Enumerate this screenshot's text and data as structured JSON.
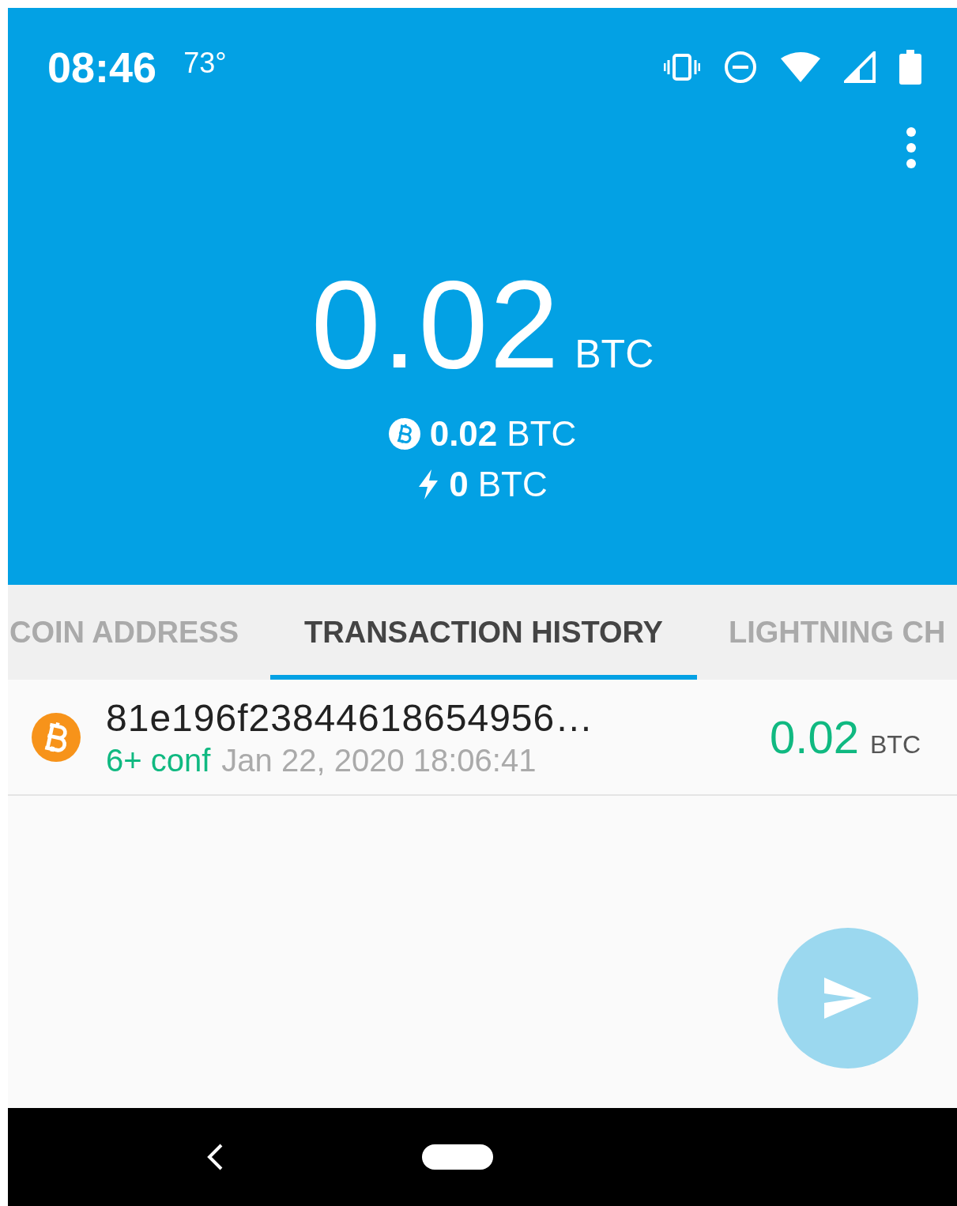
{
  "status_bar": {
    "time": "08:46",
    "temperature": "73°"
  },
  "balance": {
    "amount": "0.02",
    "unit": "BTC"
  },
  "sub_balances": [
    {
      "kind": "onchain",
      "amount": "0.02",
      "unit": "BTC"
    },
    {
      "kind": "lightning",
      "amount": "0",
      "unit": "BTC"
    }
  ],
  "tabs": [
    {
      "label": "COIN ADDRESS",
      "selected": false
    },
    {
      "label": "TRANSACTION HISTORY",
      "selected": true
    },
    {
      "label": "LIGHTNING CH",
      "selected": false
    }
  ],
  "transactions": [
    {
      "id": "81e196f23844618654956…",
      "confirmations": "6+ conf",
      "date": "Jan 22, 2020 18:06:41",
      "amount": "0.02",
      "unit": "BTC"
    }
  ]
}
